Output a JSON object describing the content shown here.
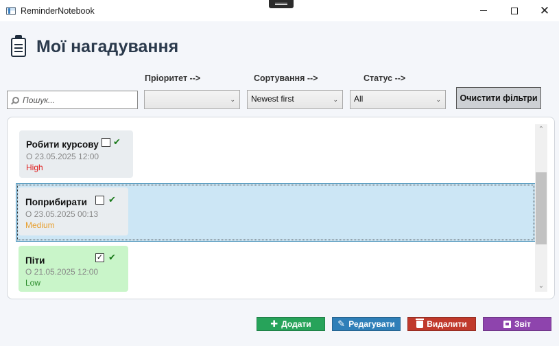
{
  "window": {
    "title": "ReminderNotebook",
    "minimize_glyph": "",
    "close_glyph": "✕"
  },
  "header": {
    "title": "Мої нагадування",
    "icon": "clipboard-icon"
  },
  "filters": {
    "priority_label": "Пріоритет -->",
    "sort_label": "Сортування -->",
    "status_label": "Статус -->",
    "search_placeholder": "Пошук...",
    "priority_value": "",
    "sort_value": "Newest first",
    "status_value": "All",
    "clear_label": "Очистити фільтри"
  },
  "reminders": [
    {
      "title": "Робити курсову",
      "date": "О 23.05.2025 12:00",
      "priority": "High",
      "priority_color": "#e02020",
      "checked": false
    },
    {
      "title": "Поприбирати",
      "date": "О 23.05.2025 00:13",
      "priority": "Medium",
      "priority_color": "#e8a030",
      "checked": false,
      "selected": true
    },
    {
      "title": "Піти",
      "date": "О 21.05.2025 12:00",
      "priority": "Low",
      "priority_color": "#2a8a2a",
      "checked": true
    }
  ],
  "check_glyph": "✔",
  "box_check_glyph": "✓",
  "actions": {
    "add_label": "Додати",
    "edit_label": "Редагувати",
    "delete_label": "Видалити",
    "report_label": "Звіт"
  },
  "colors": {
    "add": "#27a35a",
    "edit": "#2f7fb8",
    "delete": "#c0392b",
    "report": "#8e44ad",
    "selection": "#cce6f5",
    "done_card": "#c9f5c9"
  }
}
